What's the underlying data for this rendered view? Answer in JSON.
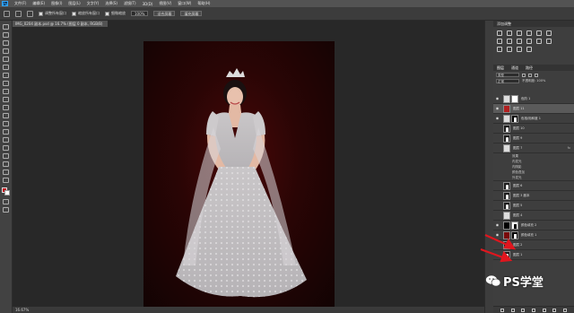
{
  "app": {
    "logo": "Ps",
    "menu": [
      "文件(F)",
      "编辑(E)",
      "图像(I)",
      "图层(L)",
      "文字(Y)",
      "选择(S)",
      "滤镜(T)",
      "3D(D)",
      "视图(V)",
      "窗口(W)",
      "帮助(H)"
    ]
  },
  "options": {
    "check1": "调整所有窗口",
    "check2": "缩放所有窗口",
    "check3": "细微缩放",
    "zoom": "100%",
    "btn1": "适合屏幕",
    "btn2": "填充屏幕"
  },
  "document": {
    "tab": "IMG_0204 副本.psd @ 16.7% (图层 0 副本, RGB/8)",
    "status": "16.67%"
  },
  "panels": {
    "tabs": [
      "图层",
      "通道",
      "路径"
    ],
    "adjust_title": "添加调整",
    "kind": "类型",
    "blend": "正常",
    "opacity_label": "不透明度: 100%"
  },
  "layers": [
    {
      "name": "色阶 1",
      "type": "adjust",
      "selected": false
    },
    {
      "name": "图层 11",
      "type": "red",
      "selected": true
    },
    {
      "name": "色相/饱和度 1",
      "type": "adjust",
      "selected": false
    },
    {
      "name": "图层 10",
      "type": "figure",
      "selected": false
    },
    {
      "name": "图层 9",
      "type": "figure",
      "selected": false
    },
    {
      "name": "图层 7",
      "type": "light",
      "selected": false,
      "fx": "fx"
    }
  ],
  "layer_effects": [
    "效果",
    "内发光",
    "内阴影",
    "颜色叠加",
    "外发光"
  ],
  "layers2": [
    {
      "name": "图层 6",
      "type": "figure"
    },
    {
      "name": "图层 3 副本",
      "type": "figure"
    },
    {
      "name": "图层 5",
      "type": "figure"
    },
    {
      "name": "图层 4",
      "type": "light"
    },
    {
      "name": "颜色填充 2",
      "type": "fill"
    },
    {
      "name": "颜色填充 1",
      "type": "fill2"
    },
    {
      "name": "图层 2",
      "type": "figure"
    },
    {
      "name": "图层 1",
      "type": "figure"
    },
    {
      "name": "背景",
      "type": "light"
    }
  ],
  "watermark": {
    "text": "PS学堂"
  },
  "colors": {
    "foreground": "#c0131b",
    "background": "#ffffff",
    "arrow": "#e0161e"
  }
}
